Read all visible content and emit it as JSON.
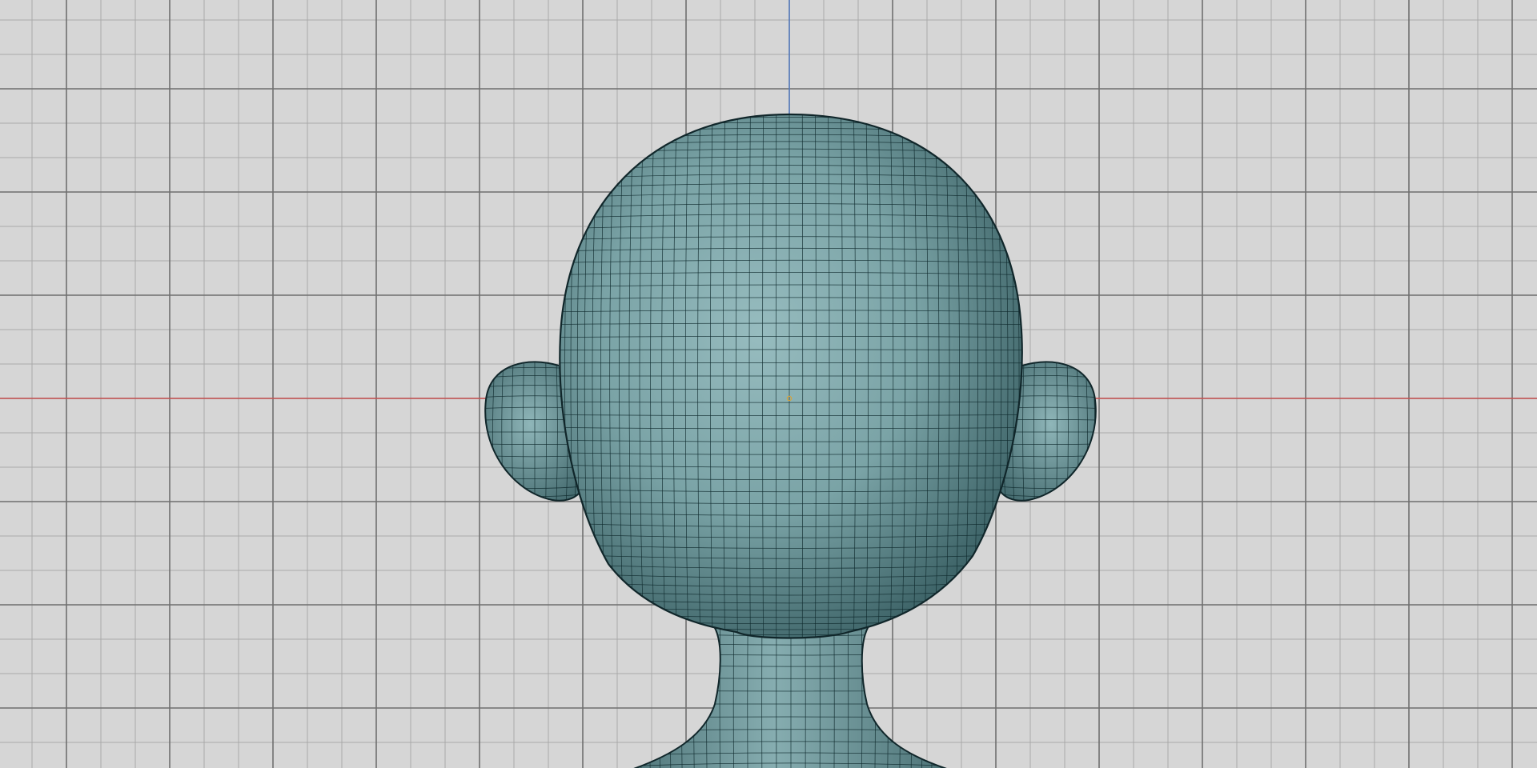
{
  "viewport": {
    "view": "front",
    "shading": "wireframe-on-shaded",
    "background_color": "#d6d6d6",
    "grid_minor_color": "#a9a9a9",
    "grid_major_color": "#6f6f6f",
    "x_axis_color": "#d94c4c",
    "z_axis_color": "#4b7fd6"
  },
  "model": {
    "object": "character-head-mesh",
    "surface_color": "#7fa8ab",
    "wire_color": "#0f2a2e",
    "outline_color": "#10262a",
    "has_left_ear": true,
    "has_right_ear": true,
    "has_neck": true
  },
  "origin_marker": {
    "color": "#d6a23a"
  }
}
